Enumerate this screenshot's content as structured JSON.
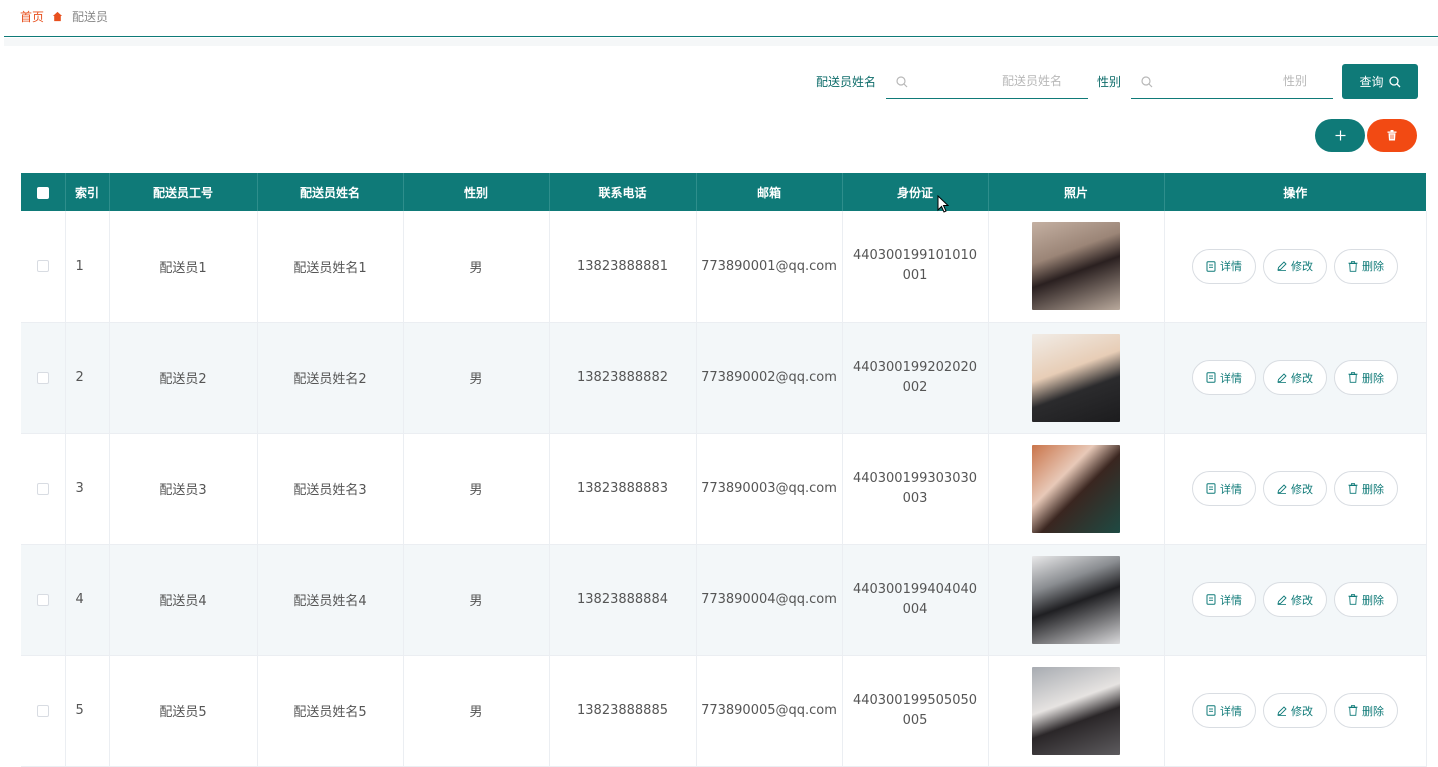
{
  "breadcrumb": {
    "home": "首页",
    "current": "配送员"
  },
  "search": {
    "name_label": "配送员姓名",
    "name_placeholder": "配送员姓名",
    "gender_label": "性别",
    "gender_placeholder": "性别",
    "query_label": "查询"
  },
  "colors": {
    "primary": "#0f7a78",
    "danger": "#f24a13",
    "breadcrumb_home": "#e8501e"
  },
  "table": {
    "headers": [
      "索引",
      "配送员工号",
      "配送员姓名",
      "性别",
      "联系电话",
      "邮箱",
      "身份证",
      "照片",
      "操作"
    ],
    "actions": {
      "detail": "详情",
      "edit": "修改",
      "delete": "删除"
    },
    "rows": [
      {
        "index": "1",
        "id": "配送员1",
        "name": "配送员姓名1",
        "gender": "男",
        "phone": "13823888881",
        "email": "773890001@qq.com",
        "idcard": "440300199101010001"
      },
      {
        "index": "2",
        "id": "配送员2",
        "name": "配送员姓名2",
        "gender": "男",
        "phone": "13823888882",
        "email": "773890002@qq.com",
        "idcard": "440300199202020002"
      },
      {
        "index": "3",
        "id": "配送员3",
        "name": "配送员姓名3",
        "gender": "男",
        "phone": "13823888883",
        "email": "773890003@qq.com",
        "idcard": "440300199303030003"
      },
      {
        "index": "4",
        "id": "配送员4",
        "name": "配送员姓名4",
        "gender": "男",
        "phone": "13823888884",
        "email": "773890004@qq.com",
        "idcard": "440300199404040004"
      },
      {
        "index": "5",
        "id": "配送员5",
        "name": "配送员姓名5",
        "gender": "男",
        "phone": "13823888885",
        "email": "773890005@qq.com",
        "idcard": "440300199505050005"
      }
    ]
  }
}
